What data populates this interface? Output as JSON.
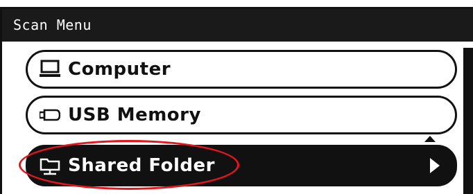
{
  "window": {
    "title": "Scan Menu"
  },
  "menu": {
    "items": [
      {
        "label": "Computer",
        "icon": "computer-icon",
        "selected": false
      },
      {
        "label": "USB Memory",
        "icon": "usb-memory-icon",
        "selected": false
      },
      {
        "label": "Shared Folder",
        "icon": "shared-folder-icon",
        "selected": true
      }
    ]
  },
  "colors": {
    "title_bar_bg": "#1a1a1a",
    "selected_bg": "#111111",
    "highlight": "#e2161b"
  }
}
